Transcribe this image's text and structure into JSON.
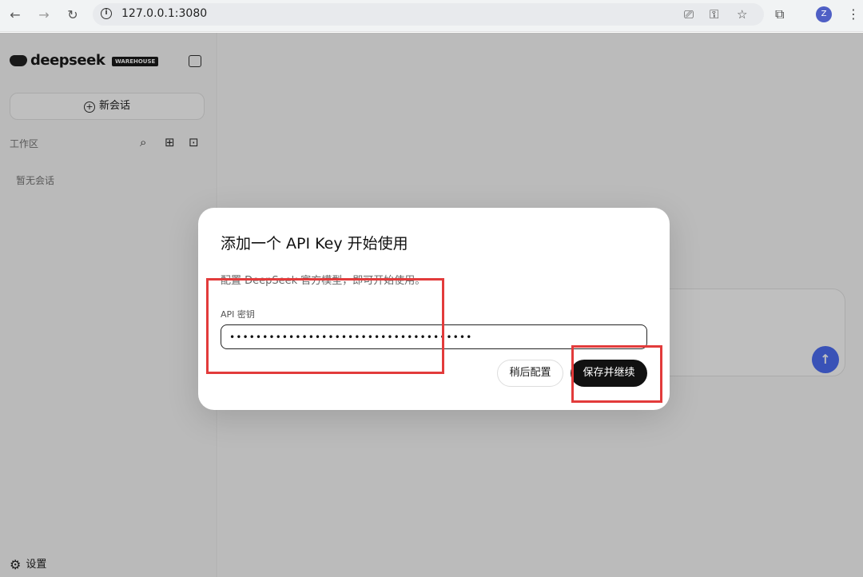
{
  "browser": {
    "url": "127.0.0.1:3080",
    "profile_initial": "Z"
  },
  "sidebar": {
    "brand": "deepseek",
    "badge": "WAREHOUSE",
    "new_chat": "新会话",
    "workspace_label": "工作区",
    "empty_text": "暂无会话",
    "settings": "设置"
  },
  "modal": {
    "title": "添加一个 API Key 开始使用",
    "description": "配置 DeepSeek 官方模型，即可开始使用。",
    "field_label": "API 密钥",
    "field_value": "•••••••••••••••••••••••••••••••••••••",
    "later_button": "稍后配置",
    "save_button": "保存并继续"
  },
  "colors": {
    "accent": "#4c6ef5",
    "annotation": "#e23b3b",
    "primary_button": "#111111"
  },
  "icons": [
    "back-icon",
    "forward-icon",
    "reload-icon",
    "info-icon",
    "install-icon",
    "key-icon",
    "star-icon",
    "extensions-icon",
    "menu-icon",
    "sidebar-toggle-icon",
    "plus-circle-icon",
    "search-icon",
    "grid-icon",
    "new-folder-icon",
    "gear-icon",
    "send-icon"
  ]
}
